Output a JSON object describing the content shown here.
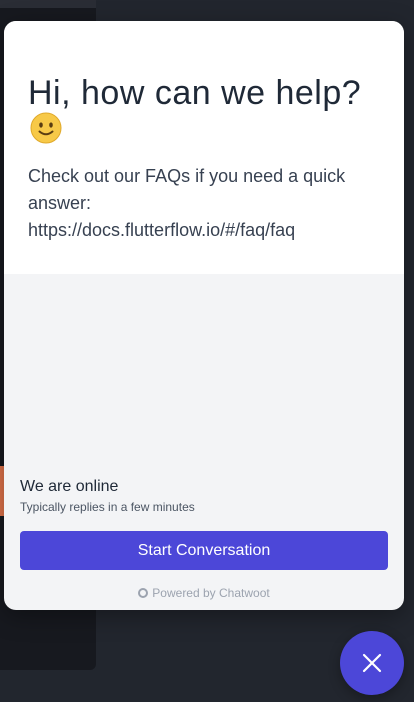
{
  "widget": {
    "greeting": "Hi, how can we help?",
    "greeting_emoji": "slightly-smiling-face-icon",
    "intro_line": "Check out our FAQs if you need a quick answer:",
    "faq_link": "https://docs.flutterflow.io/#/faq/faq",
    "status_title": "We are online",
    "status_subtitle": "Typically replies in a few minutes",
    "start_button_label": "Start Conversation",
    "branding": "Powered by Chatwoot"
  },
  "colors": {
    "accent": "#4c47d8",
    "header_bg": "#ffffff",
    "body_bg": "#f3f4f6",
    "page_bg": "#22262e"
  },
  "launcher": {
    "icon": "close-icon"
  }
}
